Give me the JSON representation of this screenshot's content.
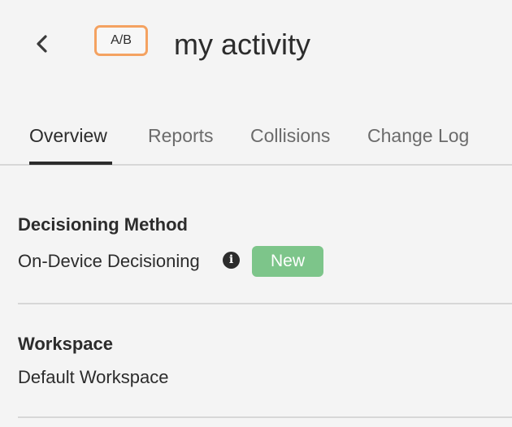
{
  "header": {
    "back_icon": "chevron-left-icon",
    "activity_type_badge": "A/B",
    "badge_color": "#f4a261",
    "title": "my activity"
  },
  "tabs": [
    {
      "label": "Overview",
      "active": true
    },
    {
      "label": "Reports",
      "active": false
    },
    {
      "label": "Collisions",
      "active": false
    },
    {
      "label": "Change Log",
      "active": false
    }
  ],
  "decisioning": {
    "label": "Decisioning Method",
    "value": "On-Device Decisioning",
    "info_icon": "info-icon",
    "status_badge": "New",
    "status_color": "#7dc58a"
  },
  "workspace": {
    "label": "Workspace",
    "value": "Default Workspace"
  }
}
